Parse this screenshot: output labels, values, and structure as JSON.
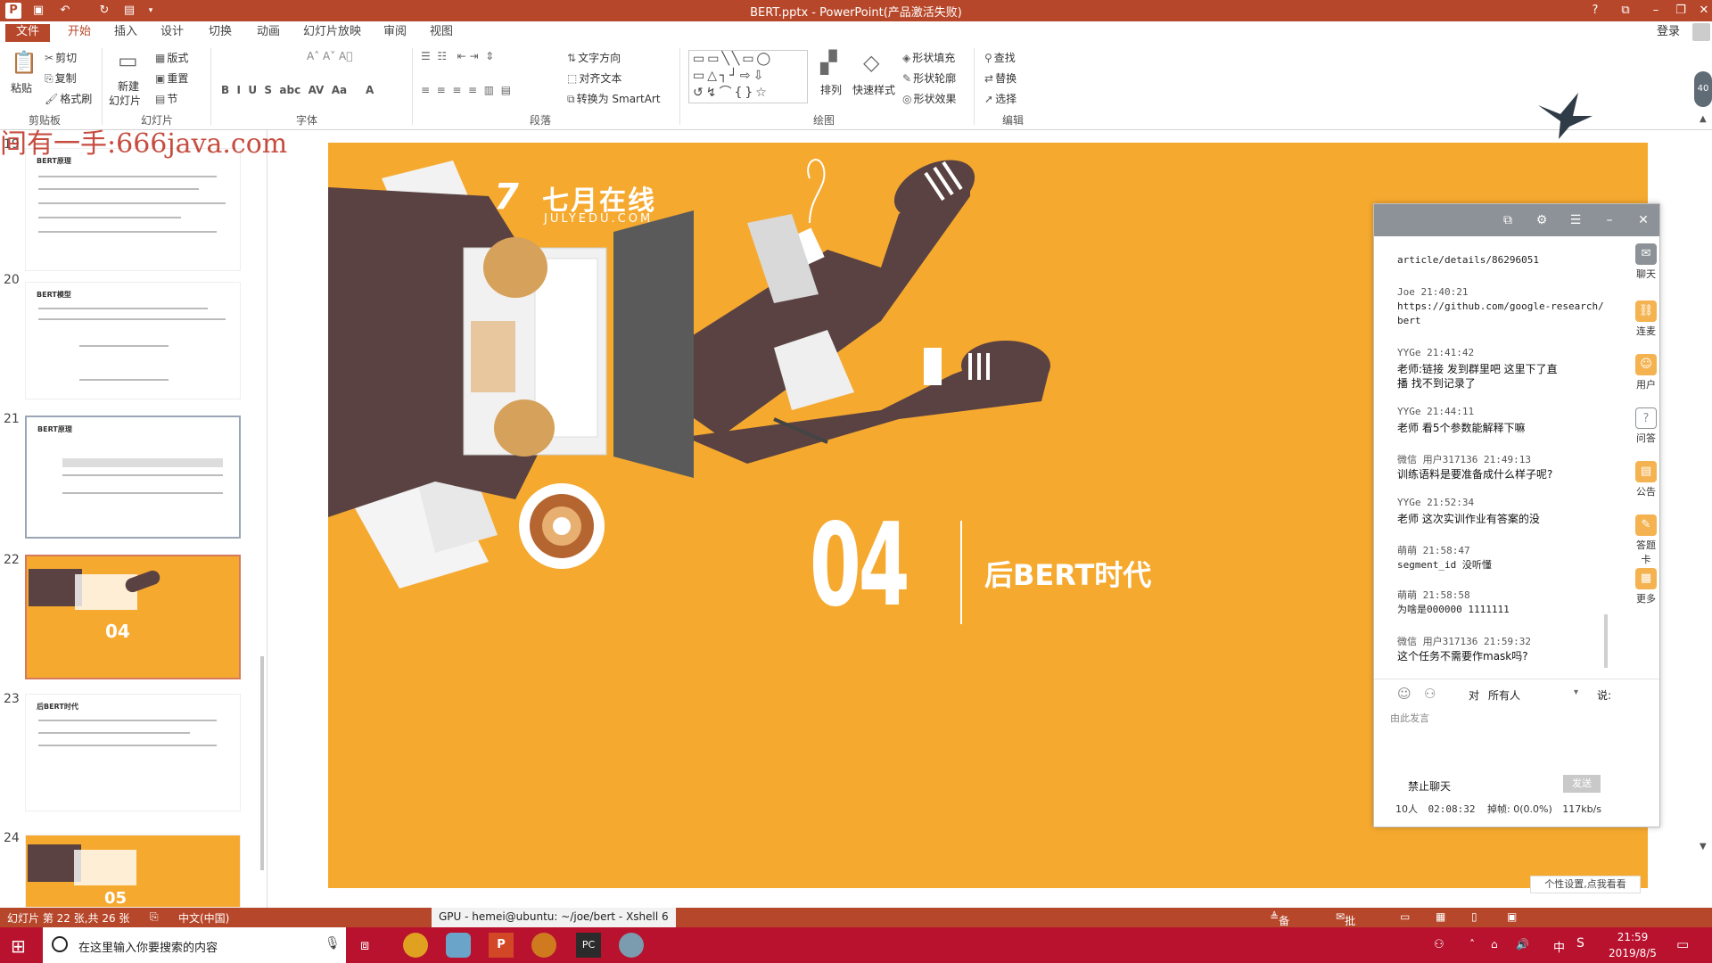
{
  "window": {
    "title": "BERT.pptx - PowerPoint(产品激活失败)",
    "help": "?",
    "controls": [
      "ribbon",
      "minimize",
      "restore",
      "close"
    ],
    "sign_in": "登录"
  },
  "tabs": [
    {
      "label": "文件"
    },
    {
      "label": "开始"
    },
    {
      "label": "插入"
    },
    {
      "label": "设计"
    },
    {
      "label": "切换"
    },
    {
      "label": "动画"
    },
    {
      "label": "幻灯片放映"
    },
    {
      "label": "审阅"
    },
    {
      "label": "视图"
    }
  ],
  "ribbon": {
    "clipboard": {
      "paste": "粘贴",
      "cut": "剪切",
      "copy": "复制",
      "format_painter": "格式刷",
      "label": "剪贴板"
    },
    "slides": {
      "new_slide": "新建",
      "new_slide2": "幻灯片",
      "layout": "版式",
      "reset": "重置",
      "section": "节",
      "label": "幻灯片"
    },
    "font": {
      "label": "字体"
    },
    "paragraph": {
      "text_direction": "文字方向",
      "align_text": "对齐文本",
      "smartart": "转换为 SmartArt",
      "label": "段落"
    },
    "drawing": {
      "arrange": "排列",
      "quick_styles": "快速样式",
      "shape_fill": "形状填充",
      "shape_outline": "形状轮廓",
      "shape_effects": "形状效果",
      "label": "绘图"
    },
    "editing": {
      "find": "查找",
      "replace": "替换",
      "select": "选择",
      "label": "编辑"
    }
  },
  "watermark": "间有一手:666java.com",
  "thumbnails": [
    {
      "num": "19",
      "title": "BERT原理"
    },
    {
      "num": "20",
      "title": "BERT模型"
    },
    {
      "num": "21",
      "title": "BERT原理"
    },
    {
      "num": "22",
      "title": "04"
    },
    {
      "num": "23",
      "title": "后BERT时代"
    },
    {
      "num": "24",
      "title": "05"
    }
  ],
  "slide": {
    "brand_cn": "七月在线",
    "brand_en": "JULYEDU.COM",
    "section_number": "04",
    "section_title": "后BERT时代",
    "bg_color": "#f6a92f"
  },
  "chat": {
    "messages": [
      {
        "meta": "",
        "text": "article/details/86296051"
      },
      {
        "meta": "Joe 21:40:21",
        "text": "https://github.com/google-research/",
        "text2": "bert"
      },
      {
        "meta": "YYGe 21:41:42",
        "text": "老师:链接  发到群里吧  这里下了直",
        "text2": "播  找不到记录了"
      },
      {
        "meta": "YYGe 21:44:11",
        "text": "老师  看5个参数能解释下嘛"
      },
      {
        "meta": "微信  用户317136 21:49:13",
        "text": "训练语料是要准备成什么样子呢?"
      },
      {
        "meta": "YYGe 21:52:34",
        "text": "老师  这次实训作业有答案的没"
      },
      {
        "meta": "萌萌 21:58:47",
        "text": "segment_id  没听懂"
      },
      {
        "meta": "萌萌 21:58:58",
        "text": "为啥是000000  1111111"
      },
      {
        "meta": "微信  用户317136 21:59:32",
        "text": "这个任务不需要作mask吗?"
      }
    ],
    "sidebar": [
      {
        "label": "聊天"
      },
      {
        "label": "连麦"
      },
      {
        "label": "用户"
      },
      {
        "label": "问答"
      },
      {
        "label": "公告"
      },
      {
        "label": "答题卡"
      },
      {
        "label": "更多"
      }
    ],
    "to_label": "对",
    "to_target": "所有人",
    "say_label": "说:",
    "input_placeholder": "由此发言",
    "ban_chat": "禁止聊天",
    "send": "发送",
    "stats": {
      "people": "10人",
      "duration": "02:08:32",
      "drop_label": "掉帧:",
      "drop": "0(0.0%)",
      "bitrate": "117kb/s"
    },
    "personal_settings": "个性设置,点我看看"
  },
  "statusbar": {
    "slide_info": "幻灯片 第 22 张,共 26 张",
    "language": "中文(中国)",
    "xshell": "GPU - hemei@ubuntu: ~/joe/bert - Xshell 6",
    "notes": "备注",
    "comments": "批注"
  },
  "taskbar": {
    "search_placeholder": "在这里输入你要搜索的内容",
    "time": "21:59",
    "date": "2019/8/5",
    "ime": "中"
  }
}
